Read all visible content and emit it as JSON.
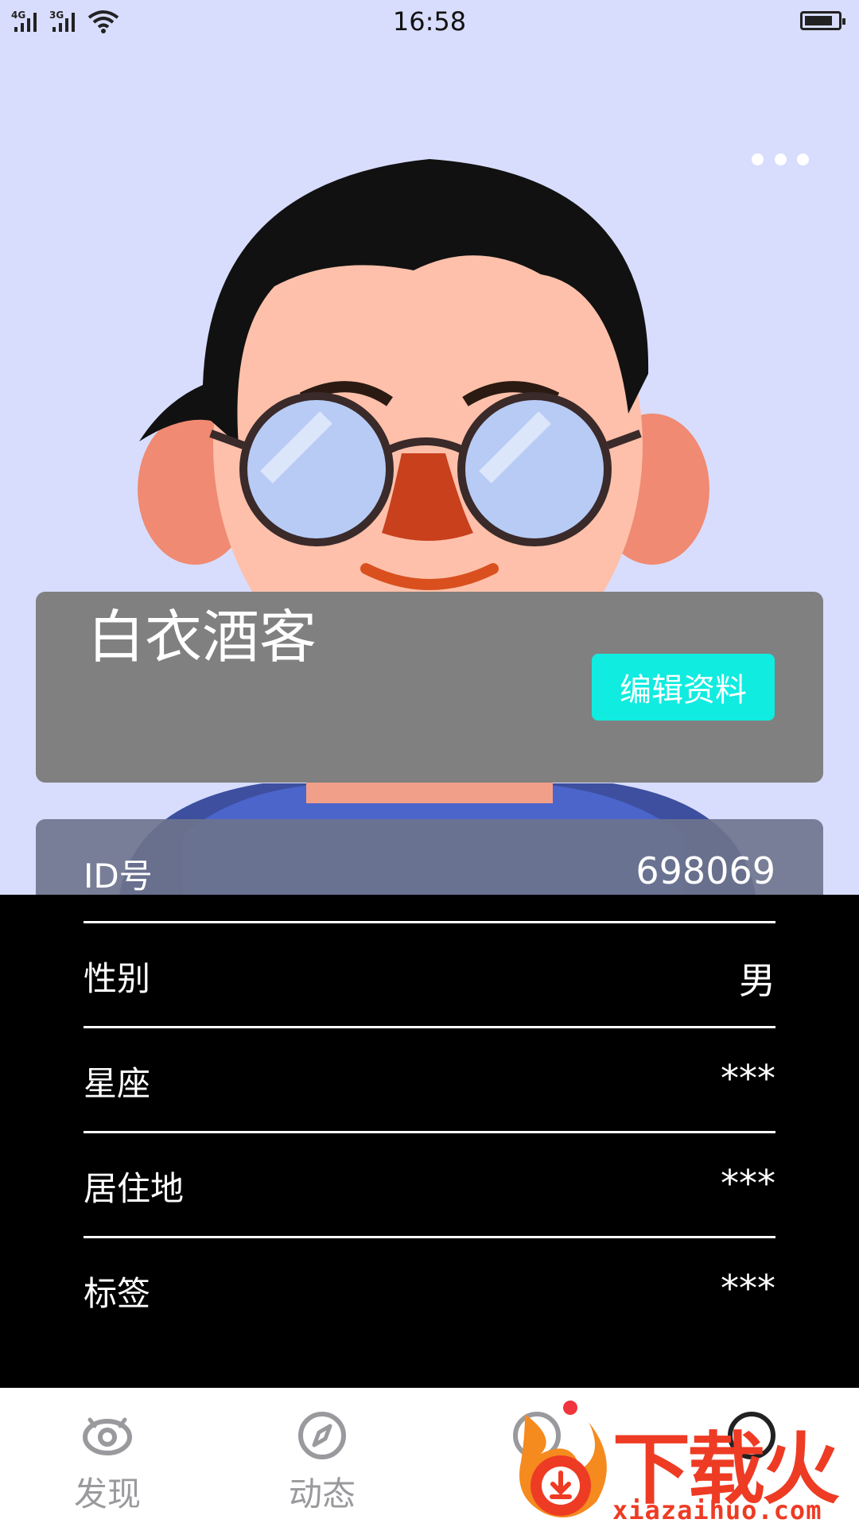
{
  "status_bar": {
    "time": "16:58",
    "signal1_tag": "4G",
    "signal2_tag": "3G"
  },
  "profile": {
    "nickname": "白衣酒客",
    "edit_label": "编辑资料"
  },
  "info_rows": [
    {
      "label": "ID号",
      "value": "698069"
    },
    {
      "label": "性别",
      "value": "男"
    },
    {
      "label": "星座",
      "value": "***"
    },
    {
      "label": "居住地",
      "value": "***"
    },
    {
      "label": "标签",
      "value": "***"
    }
  ],
  "bottom_nav": [
    {
      "label": "发现",
      "icon": "eye-icon"
    },
    {
      "label": "动态",
      "icon": "compass-icon"
    },
    {
      "label": "",
      "icon": "message-icon"
    },
    {
      "label": "",
      "icon": "profile-icon"
    }
  ],
  "watermark": {
    "title": "下载火",
    "url": "xiazaihuo.com"
  },
  "colors": {
    "hero_bg": "#d8ddfe",
    "edit_button": "#10ecdf",
    "badge": "#f0353d",
    "watermark": "#ee3b24",
    "nav_text": "#9a9a9e"
  }
}
